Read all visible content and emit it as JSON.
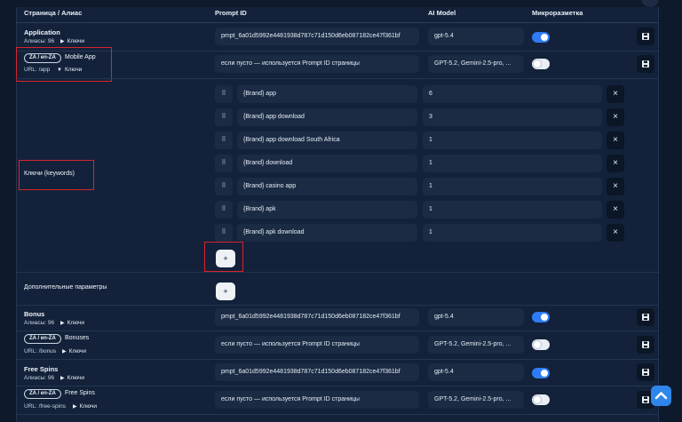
{
  "header": {
    "col_page": "Страница / Алиас",
    "col_prompt": "Prompt ID",
    "col_model": "AI Model",
    "col_markup": "Микроразметка"
  },
  "rows": [
    {
      "title": "Application",
      "sub": "Алиасы: 96",
      "toggle": "Ключи",
      "prompt": "pmpt_6a01d5992e4481938d787c71d150d6eb087182ce47f361bf",
      "model": "gpt-5.4",
      "markup_on": true
    },
    {
      "loc": "ZA / en-ZA",
      "name": "Mobile App",
      "url": "URL: /app",
      "toggle": "Ключи",
      "prompt": "если пусто — используется Prompt ID страницы",
      "model": "GPT-5.2, Gemini-2.5-pro, ...",
      "markup_on": false
    }
  ],
  "keywords": {
    "label": "Ключи (keywords)",
    "items": [
      {
        "keyword": "{Brand} app",
        "value": "6"
      },
      {
        "keyword": "{Brand} app download",
        "value": "3"
      },
      {
        "keyword": "{Brand} app download South Africa",
        "value": "1"
      },
      {
        "keyword": "{Brand} download",
        "value": "1"
      },
      {
        "keyword": "{Brand} casino app",
        "value": "1"
      },
      {
        "keyword": "{Brand} apk",
        "value": "1"
      },
      {
        "keyword": "{Brand} apk download",
        "value": "1"
      }
    ],
    "add_label": "+",
    "handle_glyph": "⠿"
  },
  "extra": {
    "label": "Дополнительные параметры",
    "add_label": "+"
  },
  "bonus": {
    "title": "Bonus",
    "sub": "Алиасы: 96",
    "toggle": "Ключи",
    "prompt": "pmpt_6a01d5992e4481938d787c71d150d6eb087182ce47f361bf",
    "model": "gpt-5.4",
    "markup_on": true
  },
  "bonuses": {
    "loc": "ZA / en-ZA",
    "name": "Bonuses",
    "url": "URL: /bonus",
    "toggle": "Ключи",
    "prompt": "если пусто — используется Prompt ID страницы",
    "model": "GPT-5.2, Gemini-2.5-pro, ...",
    "markup_on": false
  },
  "freespins": {
    "title": "Free Spins",
    "sub": "Алиасы: 96",
    "toggle": "Ключи",
    "prompt": "pmpt_6a01d5992e4481938d787c71d150d6eb087182ce47f361bf",
    "model": "gpt-5.4",
    "markup_on": true
  },
  "freespins_alias": {
    "loc": "ZA / en-ZA",
    "name": "Free Spins",
    "url": "URL: /free-spins",
    "toggle": "Ключи",
    "prompt": "если пусто — используется Prompt ID страницы",
    "model": "GPT-5.2, Gemini-2.5-pro, ...",
    "markup_on": false
  },
  "glyphs": {
    "triangle_right": "▶",
    "triangle_down": "▼",
    "close": "×"
  },
  "colors": {
    "accent": "#2f7bf5",
    "highlight": "#d9232d",
    "panel": "#13223a",
    "field": "#1b2b44"
  }
}
